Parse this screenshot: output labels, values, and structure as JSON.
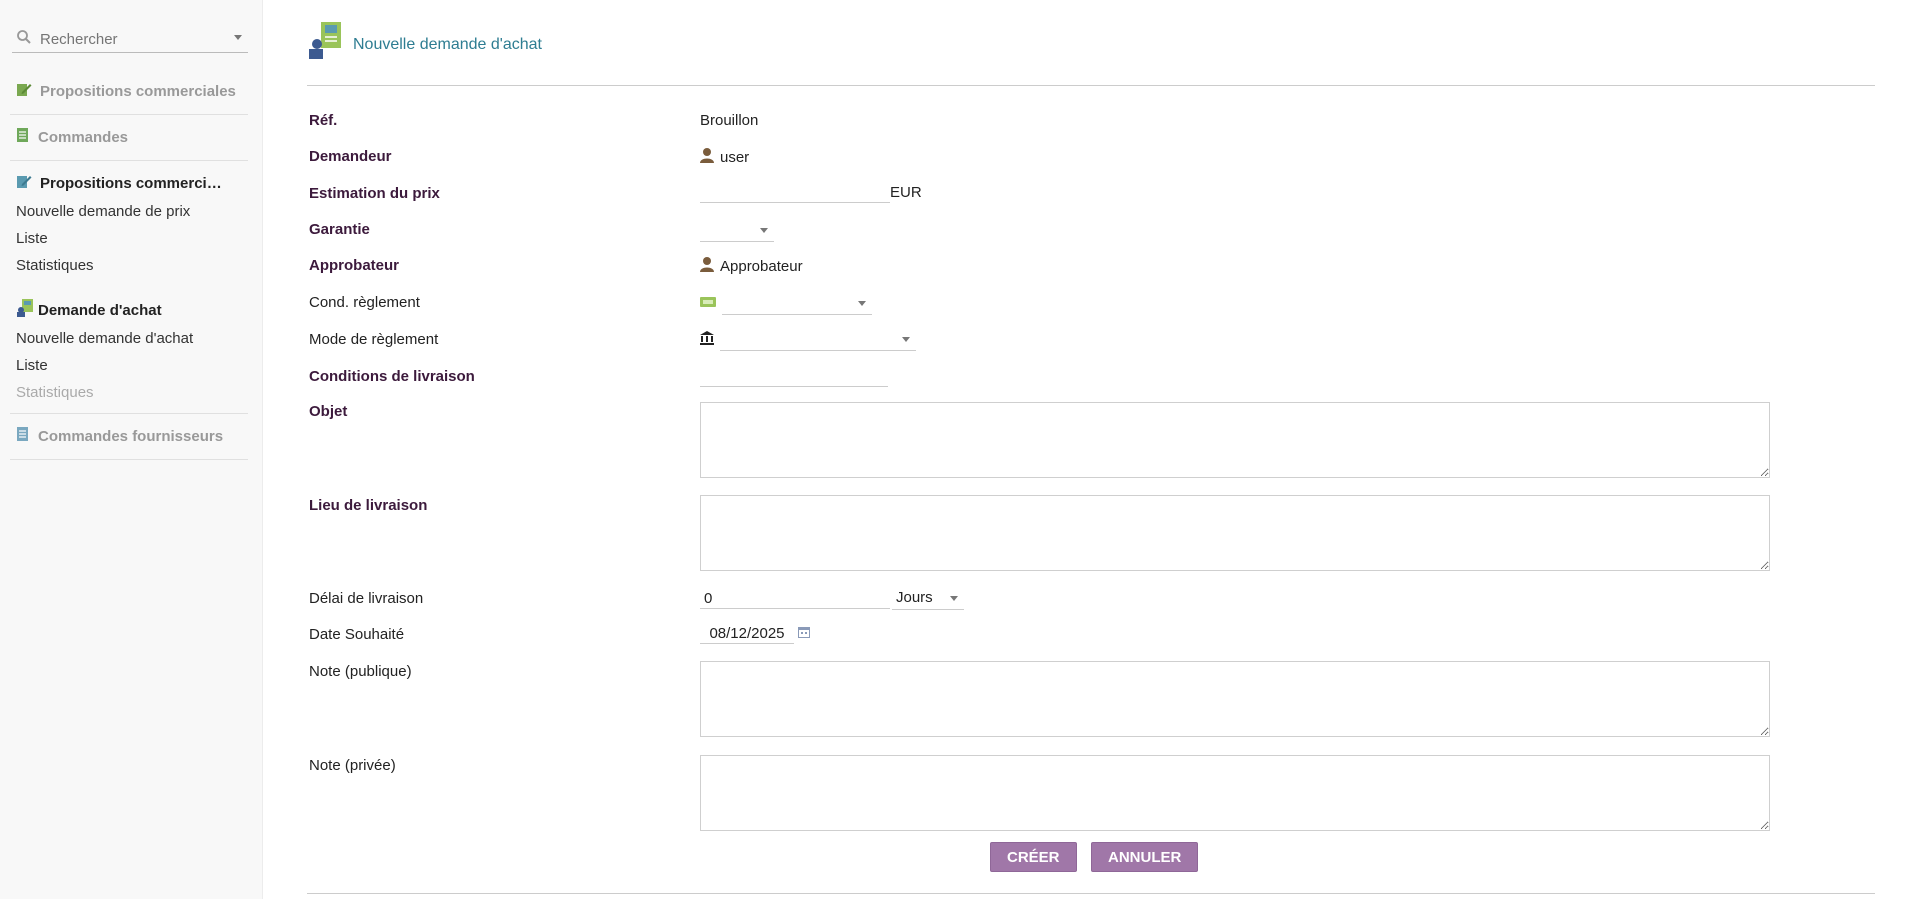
{
  "sidebar": {
    "search_placeholder": "Rechercher",
    "sections": {
      "propositions": "Propositions commerciales",
      "commandes": "Commandes",
      "propositions_fournisseurs": "Propositions commerciale …",
      "demande_achat": "Demande d'achat",
      "commandes_fournisseurs": "Commandes fournisseurs"
    },
    "propositions_fournisseurs_items": [
      "Nouvelle demande de prix",
      "Liste",
      "Statistiques"
    ],
    "demande_achat_items": [
      "Nouvelle demande d'achat",
      "Liste",
      "Statistiques"
    ]
  },
  "page": {
    "title": "Nouvelle demande d'achat"
  },
  "form": {
    "ref_label": "Réf.",
    "ref_value": "Brouillon",
    "demandeur_label": "Demandeur",
    "demandeur_value": "user",
    "estimation_label": "Estimation du prix",
    "estimation_value": "",
    "estimation_currency": "EUR",
    "garantie_label": "Garantie",
    "garantie_value": "",
    "approbateur_label": "Approbateur",
    "approbateur_value": "Approbateur",
    "cond_reglement_label": "Cond. règlement",
    "cond_reglement_value": "",
    "mode_reglement_label": "Mode de règlement",
    "mode_reglement_value": "",
    "conditions_livraison_label": "Conditions de livraison",
    "conditions_livraison_value": "",
    "objet_label": "Objet",
    "lieu_livraison_label": "Lieu de livraison",
    "delai_label": "Délai de livraison",
    "delai_value": "0",
    "delai_unit": "Jours",
    "date_label": "Date Souhaité",
    "date_value": "08/12/2025",
    "note_publique_label": "Note (publique)",
    "note_privee_label": "Note (privée)"
  },
  "buttons": {
    "create": "CRÉER",
    "cancel": "ANNULER"
  },
  "colors": {
    "accent": "#a077a8",
    "title": "#2e7d92",
    "required_label": "#3c1a3c"
  }
}
